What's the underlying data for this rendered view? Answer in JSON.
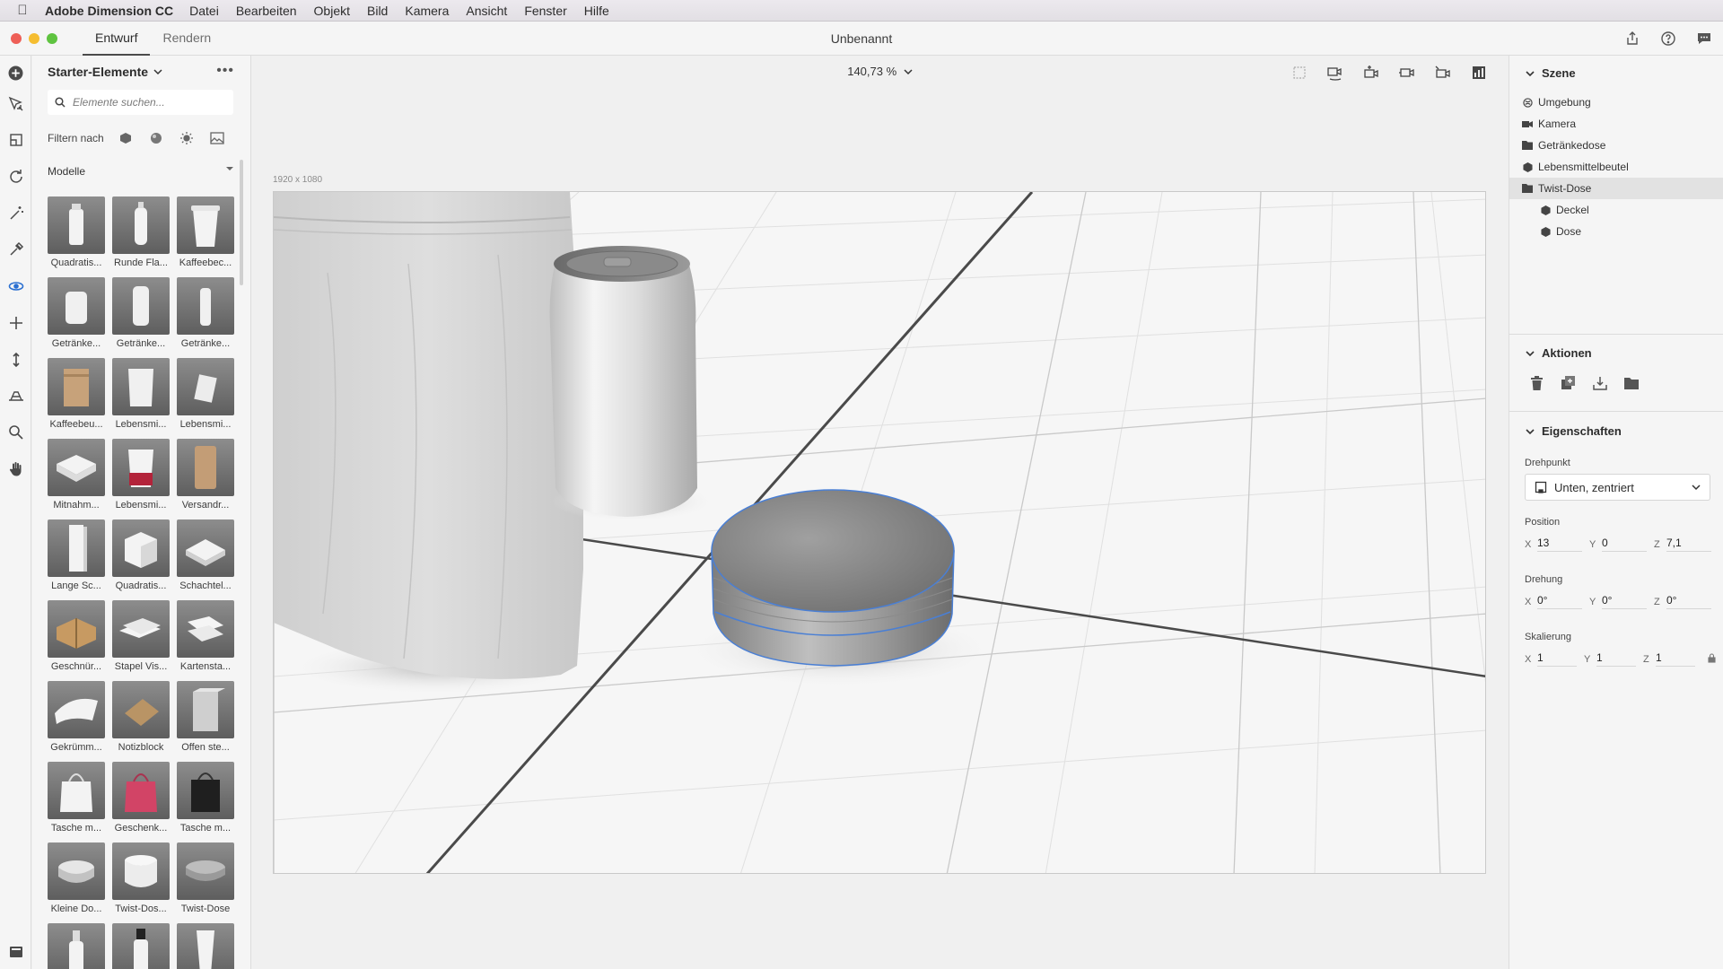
{
  "menubar": {
    "app_name": "Adobe Dimension CC",
    "items": [
      "Datei",
      "Bearbeiten",
      "Objekt",
      "Bild",
      "Kamera",
      "Ansicht",
      "Fenster",
      "Hilfe"
    ]
  },
  "window": {
    "tabs": [
      "Entwurf",
      "Rendern"
    ],
    "active_tab": "Entwurf",
    "document_title": "Unbenannt"
  },
  "assets": {
    "header": "Starter-Elemente",
    "search_placeholder": "Elemente suchen...",
    "filter_label": "Filtern nach",
    "section_label": "Modelle",
    "items": [
      {
        "label": "Quadratis...",
        "shape": "bottle-square"
      },
      {
        "label": "Runde Fla...",
        "shape": "bottle-round"
      },
      {
        "label": "Kaffeebec...",
        "shape": "cup"
      },
      {
        "label": "Getränke...",
        "shape": "can-short"
      },
      {
        "label": "Getränke...",
        "shape": "can-tall"
      },
      {
        "label": "Getränke...",
        "shape": "can-slim"
      },
      {
        "label": "Kaffeebeu...",
        "shape": "bag-brown"
      },
      {
        "label": "Lebensmi...",
        "shape": "pouch"
      },
      {
        "label": "Lebensmi...",
        "shape": "sachet"
      },
      {
        "label": "Mitnahm...",
        "shape": "takeout"
      },
      {
        "label": "Lebensmi...",
        "shape": "cup-red"
      },
      {
        "label": "Versandr...",
        "shape": "tube-kraft"
      },
      {
        "label": "Lange Sc...",
        "shape": "box-tall"
      },
      {
        "label": "Quadratis...",
        "shape": "box-cube"
      },
      {
        "label": "Schachtel...",
        "shape": "box-flat"
      },
      {
        "label": "Geschnür...",
        "shape": "parcel"
      },
      {
        "label": "Stapel Vis...",
        "shape": "cards"
      },
      {
        "label": "Kartensta...",
        "shape": "cards2"
      },
      {
        "label": "Gekrümm...",
        "shape": "paper"
      },
      {
        "label": "Notizblock",
        "shape": "notepad"
      },
      {
        "label": "Offen ste...",
        "shape": "open-box"
      },
      {
        "label": "Tasche m...",
        "shape": "bag-white"
      },
      {
        "label": "Geschenk...",
        "shape": "bag-pink"
      },
      {
        "label": "Tasche m...",
        "shape": "bag-black"
      },
      {
        "label": "Kleine Do...",
        "shape": "tin-small"
      },
      {
        "label": "Twist-Dos...",
        "shape": "jar-white"
      },
      {
        "label": "Twist-Dose",
        "shape": "tin-twist"
      },
      {
        "label": "",
        "shape": "pump"
      },
      {
        "label": "",
        "shape": "bottle-black"
      },
      {
        "label": "",
        "shape": "tube"
      }
    ]
  },
  "viewport": {
    "zoom": "140,73 %",
    "canvas_size": "1920 x 1080"
  },
  "scene": {
    "title": "Szene",
    "nodes": [
      {
        "label": "Umgebung",
        "icon": "environment-icon",
        "level": 0,
        "selected": false
      },
      {
        "label": "Kamera",
        "icon": "camera-icon",
        "level": 0,
        "selected": false
      },
      {
        "label": "Getränkedose",
        "icon": "folder-icon",
        "level": 0,
        "selected": false
      },
      {
        "label": "Lebensmittelbeutel",
        "icon": "model-icon",
        "level": 0,
        "selected": false
      },
      {
        "label": "Twist-Dose",
        "icon": "folder-icon",
        "level": 0,
        "selected": true
      },
      {
        "label": "Deckel",
        "icon": "model-icon",
        "level": 1,
        "selected": false
      },
      {
        "label": "Dose",
        "icon": "model-icon",
        "level": 1,
        "selected": false
      }
    ]
  },
  "actions": {
    "title": "Aktionen"
  },
  "properties": {
    "title": "Eigenschaften",
    "pivot_label": "Drehpunkt",
    "pivot_value": "Unten, zentriert",
    "position_label": "Position",
    "position": {
      "x": "13",
      "y": "0",
      "z": "7,1"
    },
    "rotation_label": "Drehung",
    "rotation": {
      "x": "0°",
      "y": "0°",
      "z": "0°"
    },
    "scale_label": "Skalierung",
    "scale": {
      "x": "1",
      "y": "1",
      "z": "1"
    }
  },
  "colors": {
    "accent": "#2a6fd1",
    "selection_outline": "#4a7fd4"
  }
}
